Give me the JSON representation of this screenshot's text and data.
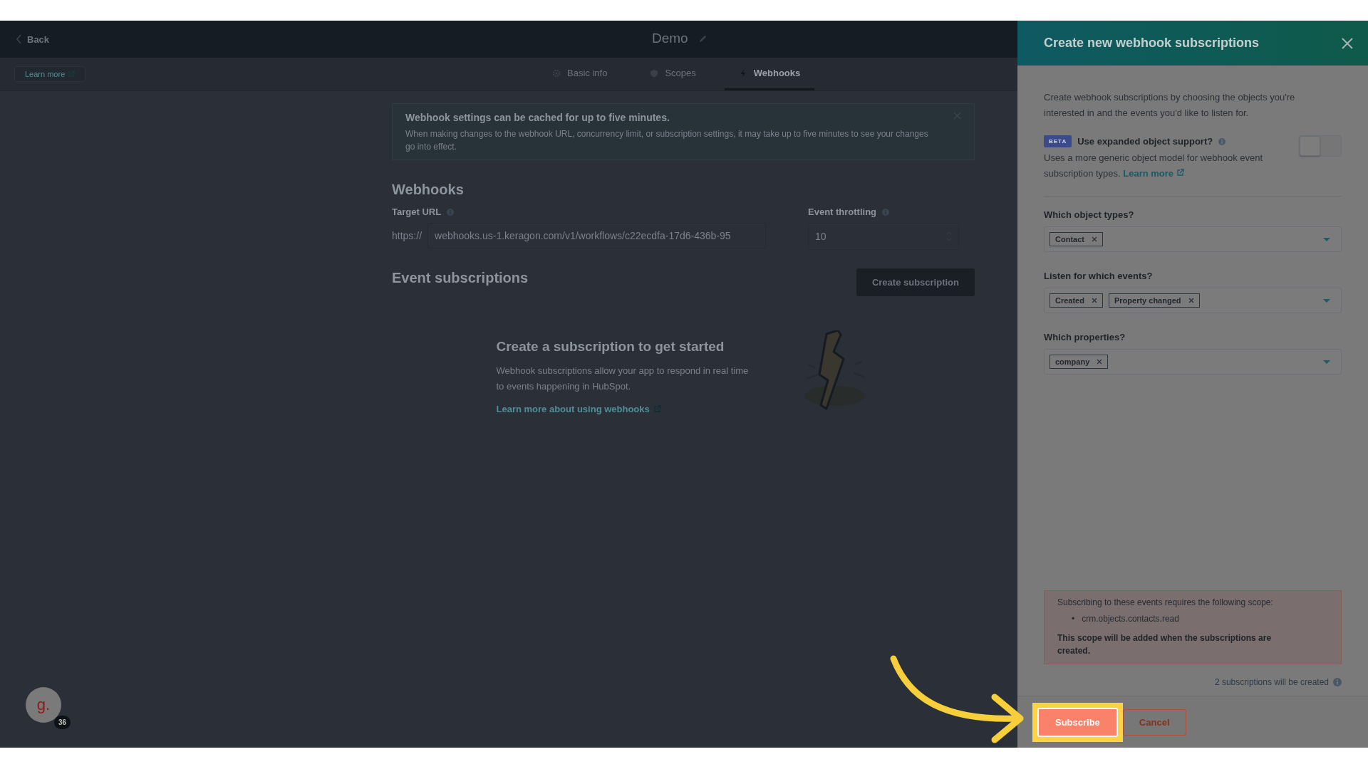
{
  "header": {
    "back": "Back",
    "title": "Demo"
  },
  "subnav": {
    "learn_more": "Learn more",
    "tabs": [
      {
        "label": "Basic info",
        "selected": false
      },
      {
        "label": "Scopes",
        "selected": false
      },
      {
        "label": "Webhooks",
        "selected": true
      }
    ]
  },
  "alert": {
    "title": "Webhook settings can be cached for up to five minutes.",
    "text": "When making changes to the webhook URL, concurrency limit, or subscription settings, it may take up to five minutes to see your changes go into effect."
  },
  "webhooks": {
    "heading": "Webhooks",
    "target_url": {
      "label": "Target URL",
      "prefix": "https://",
      "value": "webhooks.us-1.keragon.com/v1/workflows/c22ecdfa-17d6-436b-95"
    },
    "throttling": {
      "label": "Event throttling",
      "value": "10"
    }
  },
  "event_subscriptions": {
    "heading": "Event subscriptions",
    "button": "Create subscription"
  },
  "empty_state": {
    "title": "Create a subscription to get started",
    "text": "Webhook subscriptions allow your app to respond in real time to events happening in HubSpot.",
    "link": "Learn more about using webhooks"
  },
  "panel": {
    "title": "Create new webhook subscriptions",
    "intro": "Create webhook subscriptions by choosing the objects you're interested in and the events you'd like to listen for.",
    "beta": {
      "badge": "BETA",
      "label": "Use expanded object support?",
      "on": false,
      "description": "Uses a more generic object model for webhook event subscription types.",
      "link": "Learn more"
    },
    "fields": [
      {
        "label": "Which object types?",
        "tags": [
          "Contact"
        ]
      },
      {
        "label": "Listen for which events?",
        "tags": [
          "Created",
          "Property changed"
        ]
      },
      {
        "label": "Which properties?",
        "tags": [
          "company"
        ]
      }
    ],
    "scope_notice": {
      "text": "Subscribing to these events requires the following scope:",
      "bullet": "•",
      "scopes": [
        "crm.objects.contacts.read"
      ],
      "note": "This scope will be added when the subscriptions are created."
    },
    "count": "2 subscriptions will be created",
    "subscribe": "Subscribe",
    "cancel": "Cancel"
  },
  "avatar": {
    "letter": "g.",
    "badge": "36"
  }
}
